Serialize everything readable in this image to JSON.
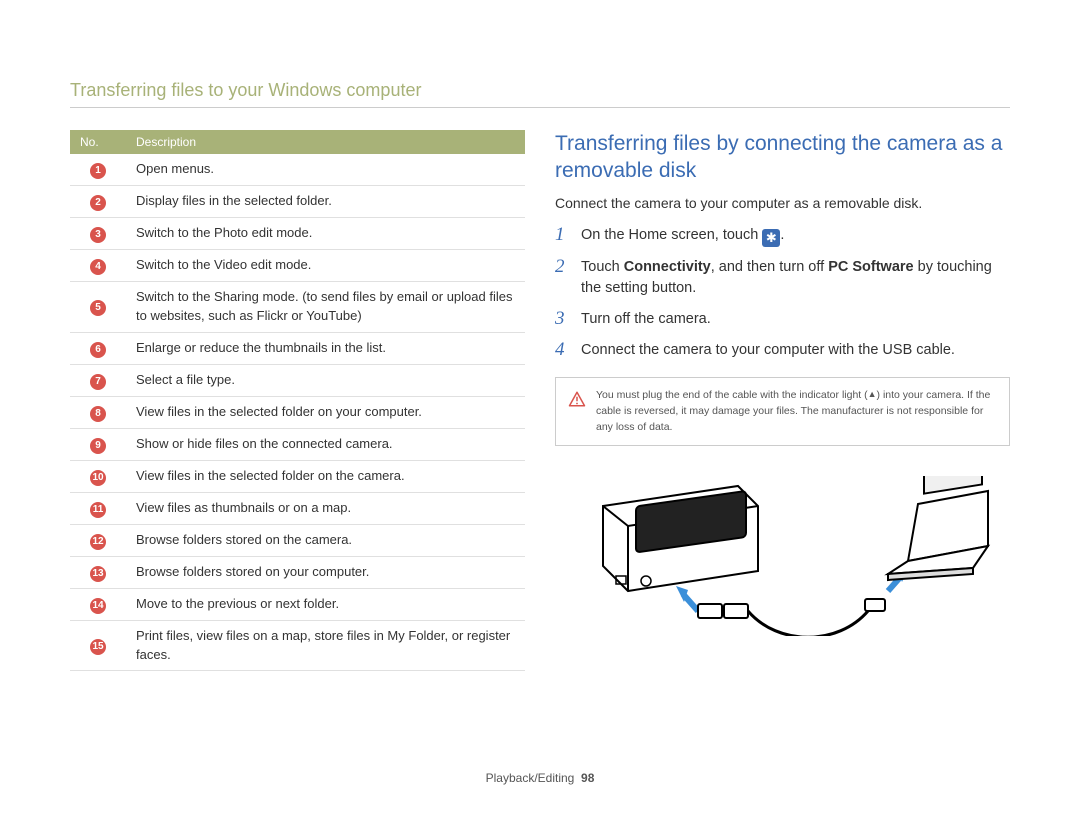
{
  "header_title": "Transferring files to your Windows computer",
  "table": {
    "head_no": "No.",
    "head_desc": "Description",
    "rows": [
      {
        "n": "1",
        "d": "Open menus."
      },
      {
        "n": "2",
        "d": "Display files in the selected folder."
      },
      {
        "n": "3",
        "d": "Switch to the Photo edit mode."
      },
      {
        "n": "4",
        "d": "Switch to the Video edit mode."
      },
      {
        "n": "5",
        "d": "Switch to the Sharing mode. (to send files by email or upload files to websites, such as Flickr or YouTube)"
      },
      {
        "n": "6",
        "d": "Enlarge or reduce the thumbnails in the list."
      },
      {
        "n": "7",
        "d": "Select a file type."
      },
      {
        "n": "8",
        "d": "View files in the selected folder on your computer."
      },
      {
        "n": "9",
        "d": "Show or hide files on the connected camera."
      },
      {
        "n": "10",
        "d": "View files in the selected folder on the camera."
      },
      {
        "n": "11",
        "d": "View files as thumbnails or on a map."
      },
      {
        "n": "12",
        "d": "Browse folders stored on the camera."
      },
      {
        "n": "13",
        "d": "Browse folders stored on your computer."
      },
      {
        "n": "14",
        "d": "Move to the previous or next folder."
      },
      {
        "n": "15",
        "d": "Print files, view files on a map, store files in My Folder, or register faces."
      }
    ]
  },
  "right": {
    "heading": "Transferring files by connecting the camera as a removable disk",
    "intro": "Connect the camera to your computer as a removable disk.",
    "gear_icon_name": "settings-gear-icon",
    "step1_prefix": "On the Home screen, touch ",
    "step1_suffix": ".",
    "step2_a": "Touch ",
    "step2_b": "Connectivity",
    "step2_c": ", and then turn off ",
    "step2_d": "PC Software",
    "step2_e": " by touching the setting button.",
    "step3": "Turn off the camera.",
    "step4": "Connect the camera to your computer with the USB cable.",
    "warning_pre": "You must plug the end of the cable with the indicator light (",
    "warning_post": ") into your camera. If the cable is reversed, it may damage your files. The manufacturer is not responsible for any loss of data."
  },
  "footer": {
    "section": "Playback/Editing",
    "page": "98"
  }
}
